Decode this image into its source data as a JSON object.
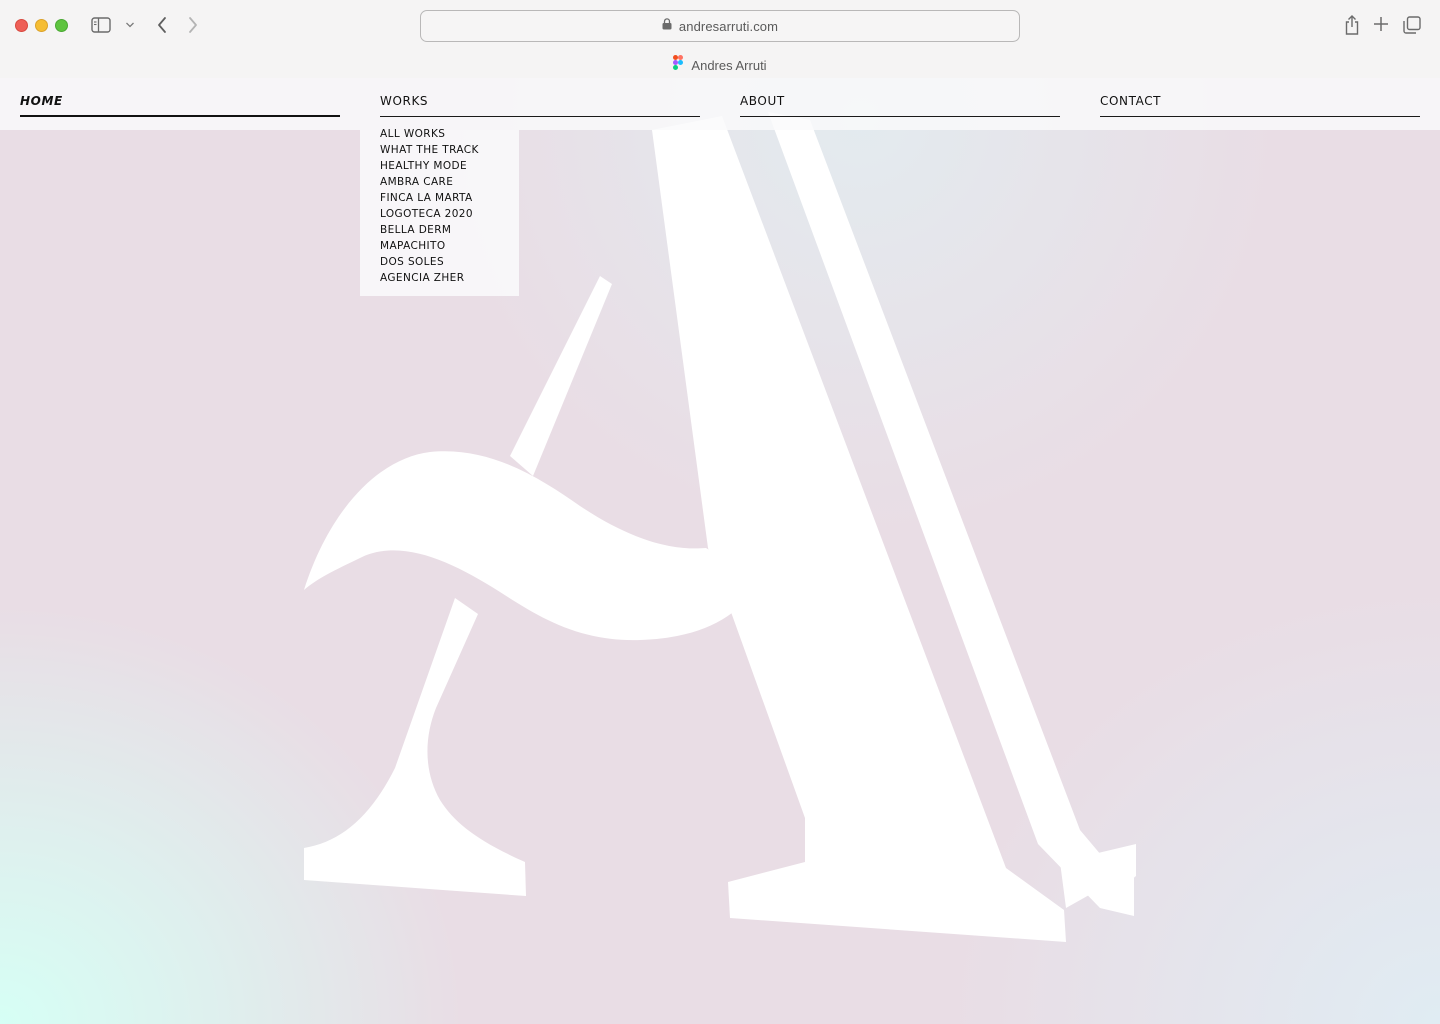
{
  "browser": {
    "url": "andresarruti.com",
    "tab_title": "Andres Arruti"
  },
  "nav": {
    "items": [
      {
        "label": "HOME"
      },
      {
        "label": "WORKS"
      },
      {
        "label": "ABOUT"
      },
      {
        "label": "CONTACT"
      }
    ],
    "active": "HOME"
  },
  "works_menu": {
    "items": [
      "ALL WORKS",
      "WHAT THE TRACK",
      "HEALTHY MODE",
      "AMBRA CARE",
      "FINCA LA MARTA",
      "LOGOTECA 2020",
      "BELLA DERM",
      "MAPACHITO",
      "DOS SOLES",
      "AGENCIA ZHER"
    ]
  },
  "hero": {
    "graphic": "letter-a-monogram"
  },
  "colors": {
    "page_background": "#e9dde5",
    "mint_glow": "#d6fff5",
    "nav_text": "#111111"
  }
}
